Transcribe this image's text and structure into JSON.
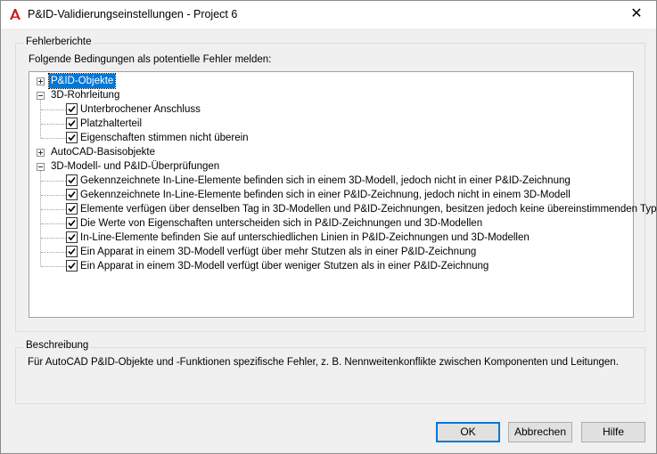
{
  "window": {
    "title": "P&ID-Validierungseinstellungen - Project 6",
    "close_glyph": "✕",
    "accent": "#0078d7"
  },
  "errors_group": {
    "legend": "Fehlerberichte",
    "prompt": "Folgende Bedingungen als potentielle Fehler melden:"
  },
  "tree": [
    {
      "label": "P&ID-Objekte",
      "level": 0,
      "expander": "+",
      "selected": true
    },
    {
      "label": "3D-Rohrleitung",
      "level": 0,
      "expander": "-"
    },
    {
      "label": "Unterbrochener Anschluss",
      "level": 1,
      "checked": true
    },
    {
      "label": "Platzhalterteil",
      "level": 1,
      "checked": true
    },
    {
      "label": "Eigenschaften stimmen nicht überein",
      "level": 1,
      "checked": true
    },
    {
      "label": "AutoCAD-Basisobjekte",
      "level": 0,
      "expander": "+"
    },
    {
      "label": "3D-Modell- und P&ID-Überprüfungen",
      "level": 0,
      "expander": "-"
    },
    {
      "label": "Gekennzeichnete In-Line-Elemente befinden sich in einem 3D-Modell, jedoch nicht in einer P&ID-Zeichnung",
      "level": 1,
      "checked": true
    },
    {
      "label": "Gekennzeichnete In-Line-Elemente befinden sich in einer P&ID-Zeichnung, jedoch nicht in einem 3D-Modell",
      "level": 1,
      "checked": true
    },
    {
      "label": "Elemente verfügen über denselben Tag in 3D-Modellen und P&ID-Zeichnungen, besitzen jedoch keine übereinstimmenden Typen",
      "level": 1,
      "checked": true
    },
    {
      "label": "Die Werte von Eigenschaften unterscheiden sich in P&ID-Zeichnungen und 3D-Modellen",
      "level": 1,
      "checked": true
    },
    {
      "label": "In-Line-Elemente befinden Sie auf unterschiedlichen Linien in P&ID-Zeichnungen und 3D-Modellen",
      "level": 1,
      "checked": true
    },
    {
      "label": "Ein Apparat in einem 3D-Modell verfügt über mehr Stutzen als in einer P&ID-Zeichnung",
      "level": 1,
      "checked": true
    },
    {
      "label": "Ein Apparat in einem 3D-Modell verfügt über weniger Stutzen als in einer P&ID-Zeichnung",
      "level": 1,
      "checked": true
    }
  ],
  "description_group": {
    "legend": "Beschreibung",
    "text": "Für AutoCAD P&ID-Objekte und -Funktionen spezifische Fehler, z. B. Nennweitenkonflikte zwischen Komponenten und Leitungen."
  },
  "buttons": {
    "ok": "OK",
    "cancel": "Abbrechen",
    "help": "Hilfe"
  }
}
